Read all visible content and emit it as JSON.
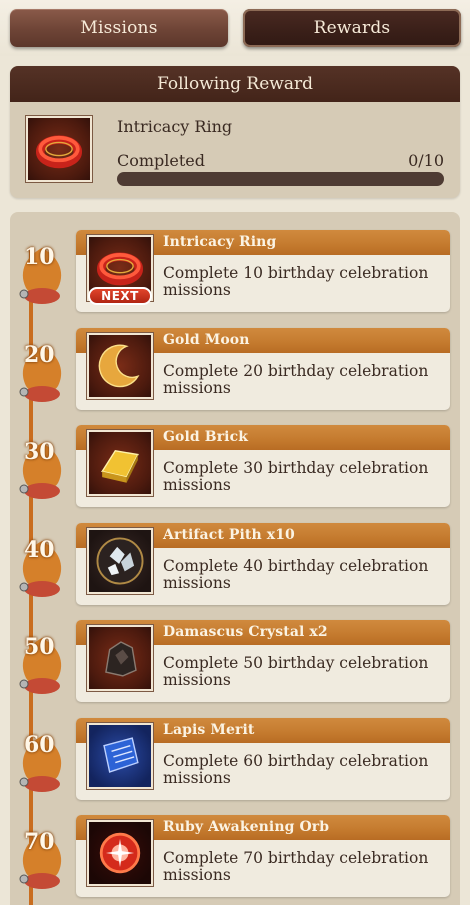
{
  "tabs": [
    {
      "label": "Missions",
      "active": false
    },
    {
      "label": "Rewards",
      "active": true
    }
  ],
  "following": {
    "header": "Following Reward",
    "item_name": "Intricacy Ring",
    "completed_label": "Completed",
    "count": "0/10",
    "progress": 0,
    "icon": "ring-icon"
  },
  "rewards": [
    {
      "milestone": "10",
      "name": "Intricacy Ring",
      "desc": "Complete 10 birthday celebration missions",
      "icon": "ring-icon",
      "badge": "NEXT"
    },
    {
      "milestone": "20",
      "name": "Gold Moon",
      "desc": "Complete 20 birthday celebration missions",
      "icon": "moon-icon"
    },
    {
      "milestone": "30",
      "name": "Gold Brick",
      "desc": "Complete 30 birthday celebration missions",
      "icon": "gold-brick-icon"
    },
    {
      "milestone": "40",
      "name": "Artifact Pith x10",
      "desc": "Complete 40 birthday celebration missions",
      "icon": "crystal-icon"
    },
    {
      "milestone": "50",
      "name": "Damascus Crystal x2",
      "desc": "Complete 50 birthday celebration missions",
      "icon": "ore-icon"
    },
    {
      "milestone": "60",
      "name": "Lapis Merit",
      "desc": "Complete 60 birthday celebration missions",
      "icon": "scroll-icon"
    },
    {
      "milestone": "70",
      "name": "Ruby Awakening Orb",
      "desc": "Complete 70 birthday celebration missions",
      "icon": "orb-icon"
    }
  ],
  "colors": {
    "accent_orange": "#c47a2e",
    "dark_brown": "#432419",
    "progress_track": "#4e3b33"
  }
}
